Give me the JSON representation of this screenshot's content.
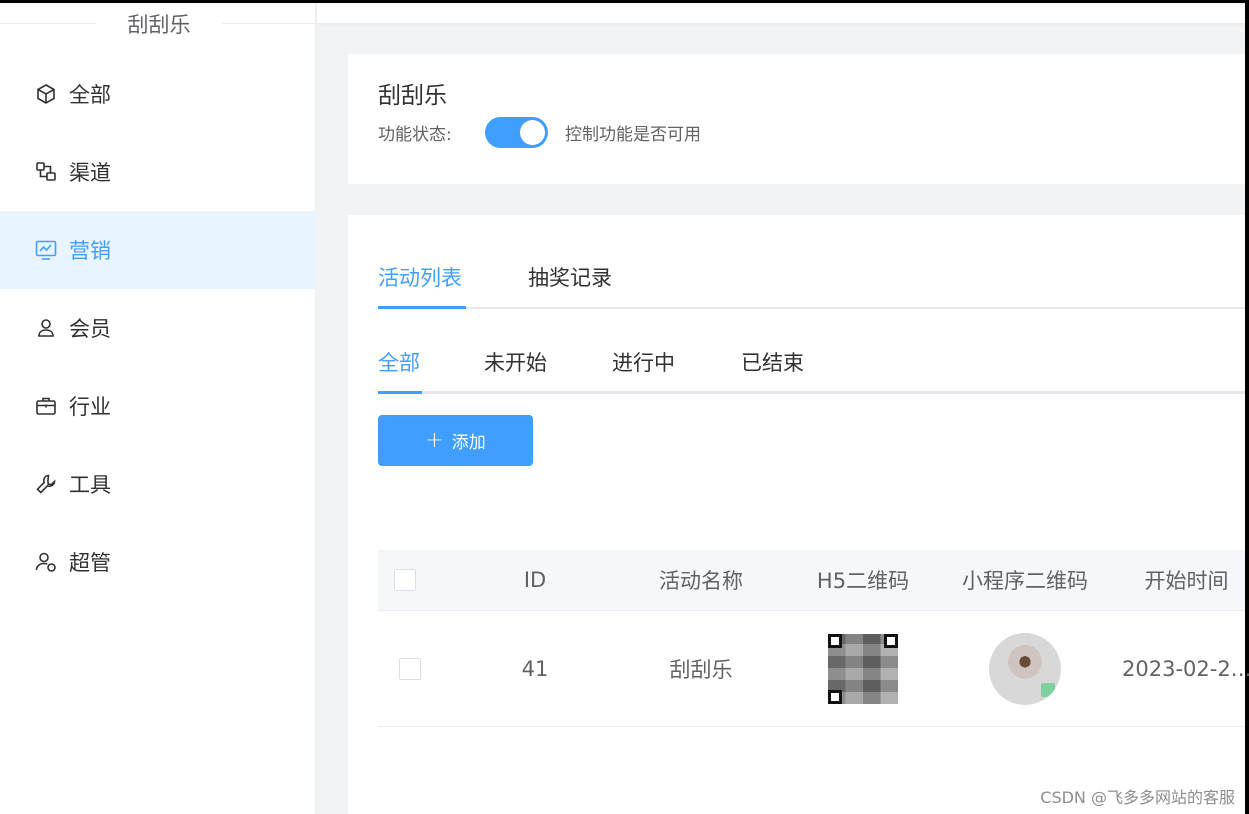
{
  "sidebar": {
    "title": "刮刮乐",
    "items": [
      {
        "label": "全部",
        "icon": "cube-icon"
      },
      {
        "label": "渠道",
        "icon": "channel-icon"
      },
      {
        "label": "营销",
        "icon": "chart-icon",
        "active": true
      },
      {
        "label": "会员",
        "icon": "user-icon"
      },
      {
        "label": "行业",
        "icon": "briefcase-icon"
      },
      {
        "label": "工具",
        "icon": "wrench-icon"
      },
      {
        "label": "超管",
        "icon": "admin-icon"
      }
    ]
  },
  "feature": {
    "title": "刮刮乐",
    "status_label": "功能状态:",
    "switch_on": true,
    "switch_desc": "控制功能是否可用"
  },
  "tabs": [
    {
      "label": "活动列表",
      "active": true
    },
    {
      "label": "抽奖记录",
      "active": false
    }
  ],
  "filter_tabs": [
    {
      "label": "全部",
      "active": true
    },
    {
      "label": "未开始",
      "active": false
    },
    {
      "label": "进行中",
      "active": false
    },
    {
      "label": "已结束",
      "active": false
    }
  ],
  "add_button": {
    "label": "添加"
  },
  "table": {
    "columns": [
      "ID",
      "活动名称",
      "H5二维码",
      "小程序二维码",
      "开始时间"
    ],
    "rows": [
      {
        "id": "41",
        "name": "刮刮乐",
        "start_time": "2023-02-2…"
      }
    ]
  },
  "watermark": "CSDN @飞多多网站的客服",
  "colors": {
    "accent": "#409eff",
    "active_bg": "#e8f4ff"
  }
}
